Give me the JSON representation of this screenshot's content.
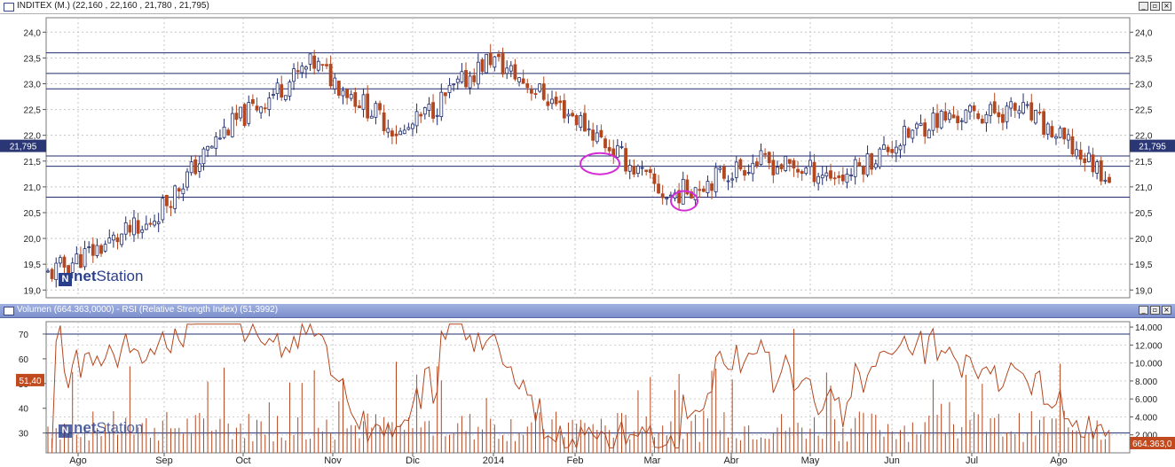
{
  "price_panel": {
    "title": "INDITEX (M.) (22,160 , 22,160 , 21,780 , 21,795)",
    "last_label": "21,795"
  },
  "rsi_panel": {
    "title": "Volumen (664.363,0000) - RSI (Relative Strength Index) (51,3992)",
    "rsi_label": "51,40",
    "volume_label": "664.363,0"
  },
  "window_buttons": {
    "minimize": "_",
    "restore": "▫",
    "close": "×"
  },
  "logo": {
    "mark": "N",
    "net": "net",
    "station": "Station"
  },
  "colors": {
    "up": "#1f2b6e",
    "down": "#b4471f",
    "line": "#1f2b6e",
    "rsi": "#b4471f",
    "label_bg": "#2b3775",
    "rsi_label_bg": "#c04a1e",
    "ellipse": "#d52bd5"
  },
  "chart_data": [
    {
      "type": "candlestick",
      "title": "INDITEX (M.) (22,160 , 22,160 , 21,780 , 21,795)",
      "ylim": [
        18.85,
        24.28
      ],
      "y_ticks": [
        "24,0",
        "23,5",
        "23,0",
        "22,5",
        "22,0",
        "21,5",
        "21,0",
        "20,5",
        "20,0",
        "19,5",
        "19,0"
      ],
      "x_ticks": [
        "Ago",
        "Sep",
        "Oct",
        "Nov",
        "Dic",
        "2014",
        "Feb",
        "Mar",
        "Abr",
        "May",
        "Jun",
        "Jul",
        "Ago"
      ],
      "grid": true,
      "horizontal_lines": [
        23.6,
        23.2,
        22.9,
        21.6,
        21.4,
        20.8
      ],
      "last_value": 21.795,
      "close_by_month": [
        {
          "month": "Ago",
          "start": 19.3,
          "end": 20.2
        },
        {
          "month": "Sep",
          "start": 20.0,
          "end": 22.1
        },
        {
          "month": "Oct",
          "start": 22.1,
          "end": 23.4
        },
        {
          "month": "Nov",
          "start": 23.4,
          "end": 22.0
        },
        {
          "month": "Dic",
          "start": 22.0,
          "end": 23.5
        },
        {
          "month": "2014",
          "start": 23.5,
          "end": 22.3
        },
        {
          "month": "Feb",
          "start": 22.3,
          "end": 20.8
        },
        {
          "month": "Mar",
          "start": 20.8,
          "end": 21.5
        },
        {
          "month": "Abr",
          "start": 21.5,
          "end": 21.2
        },
        {
          "month": "May",
          "start": 21.2,
          "end": 22.3
        },
        {
          "month": "Jun",
          "start": 22.3,
          "end": 22.5
        },
        {
          "month": "Jul",
          "start": 22.5,
          "end": 21.2
        },
        {
          "month": "Ago",
          "start": 21.2,
          "end": 21.8
        }
      ]
    },
    {
      "type": "line",
      "series": [
        {
          "name": "RSI (Relative Strength Index)",
          "last": 51.3992
        },
        {
          "name": "Volumen",
          "last": 664363
        }
      ],
      "y_ticks_left": [
        "70",
        "60",
        "50",
        "40",
        "30"
      ],
      "ylim_left": [
        22,
        75
      ],
      "y_ticks_right": [
        "14.000",
        "12.000",
        "10.000",
        "8.000",
        "6.000",
        "4.000",
        "2.000"
      ],
      "ylim_right": [
        0,
        14600
      ],
      "reference_lines": [
        70,
        30
      ],
      "x_ticks": [
        "Ago",
        "Sep",
        "Oct",
        "Nov",
        "Dic",
        "2014",
        "Feb",
        "Mar",
        "Abr",
        "May",
        "Jun",
        "Jul",
        "Ago"
      ]
    }
  ]
}
